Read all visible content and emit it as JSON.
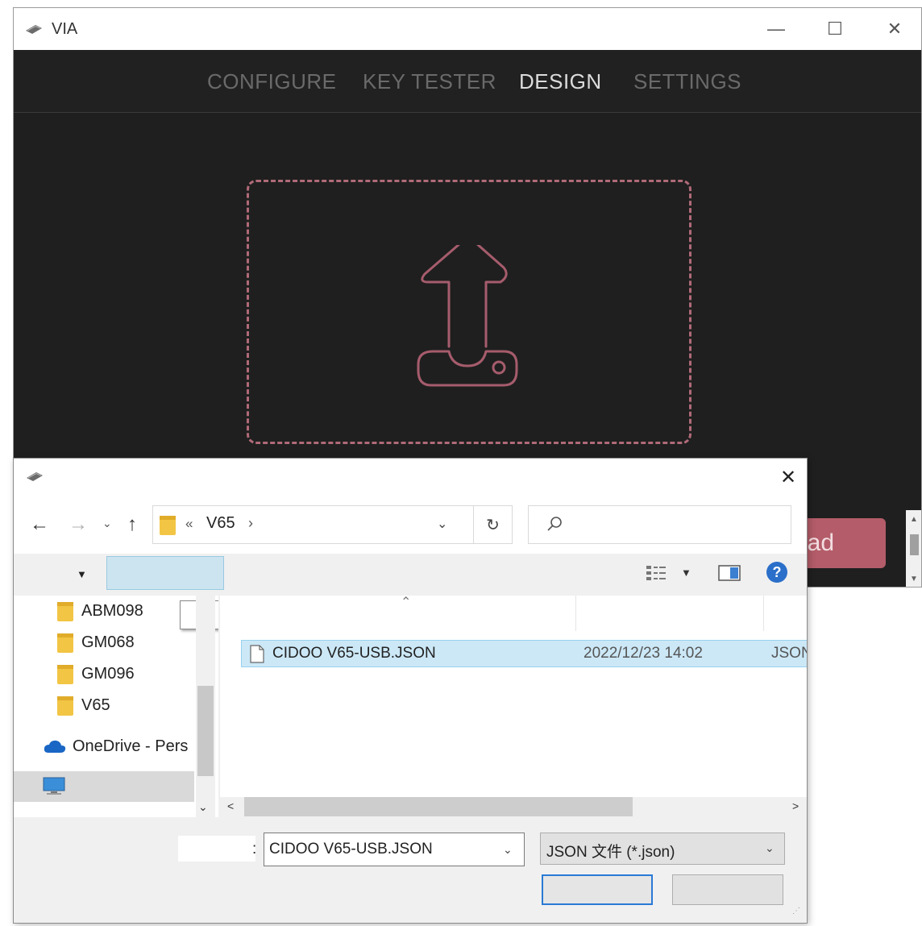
{
  "via": {
    "title": "VIA",
    "logo_icon": "keyboard-icon",
    "window_controls": {
      "minimize": "—",
      "maximize": "☐",
      "close": "✕"
    },
    "tabs": [
      {
        "label": "CONFIGURE",
        "active": false
      },
      {
        "label": "KEY TESTER",
        "active": false
      },
      {
        "label": "DESIGN",
        "active": true
      },
      {
        "label": "SETTINGS",
        "active": false
      }
    ],
    "upload_icon": "upload-icon",
    "load_button_label": "oad",
    "accent_color": "#b45c69"
  },
  "dialog": {
    "close_glyph": "✕",
    "nav": {
      "back": "←",
      "forward": "→",
      "recent": "⌄",
      "up": "↑"
    },
    "address": {
      "chevron": "«",
      "path": "V65",
      "separator": "›"
    },
    "search": {
      "placeholder": ""
    },
    "tree": [
      {
        "label": "ABM098",
        "icon": "folder-icon"
      },
      {
        "label": "GM068",
        "icon": "folder-icon"
      },
      {
        "label": "GM096",
        "icon": "folder-icon"
      },
      {
        "label": "V65",
        "icon": "folder-icon"
      },
      {
        "label": "OneDrive - Pers",
        "icon": "cloud-icon"
      },
      {
        "label": "",
        "icon": "computer-icon"
      }
    ],
    "files": [
      {
        "name": "CIDOO V65-USB.JSON",
        "date": "2022/12/23 14:02",
        "type": "JSON",
        "selected": true
      }
    ],
    "filename_colon": ":",
    "filename_value": "CIDOO V65-USB.JSON",
    "filter_value": "JSON 文件 (*.json)",
    "selected_color": "#cce8f7"
  }
}
